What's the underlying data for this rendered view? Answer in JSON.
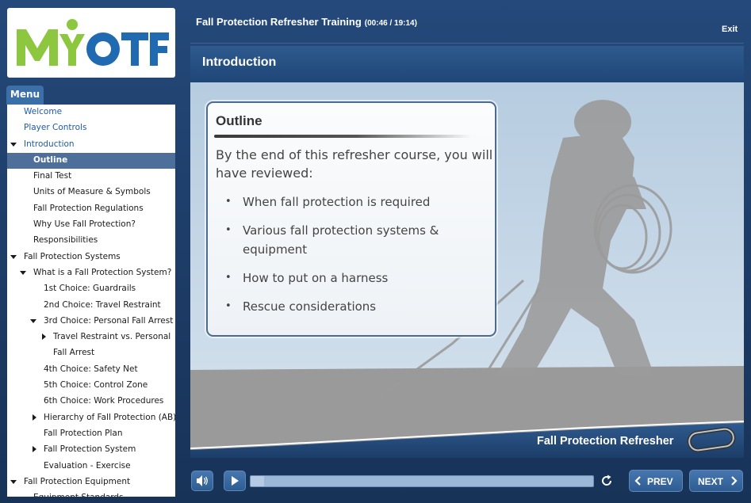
{
  "header": {
    "course_title": "Fall Protection Refresher Training",
    "course_time": "(00:46 / 19:14)",
    "exit_label": "Exit"
  },
  "logo": {
    "text": "MYOTF",
    "colors": {
      "green": "#8dc63f",
      "blue": "#1f6ab0"
    }
  },
  "menu": {
    "tab_label": "Menu",
    "items": [
      {
        "label": "Welcome",
        "level": 0,
        "caret": "none",
        "style": "blue"
      },
      {
        "label": "Player Controls",
        "level": 0,
        "caret": "none",
        "style": "blue"
      },
      {
        "label": "Introduction",
        "level": 0,
        "caret": "down",
        "style": "blue"
      },
      {
        "label": "Outline",
        "level": 1,
        "caret": "none",
        "style": "selected"
      },
      {
        "label": "Final Test",
        "level": 1,
        "caret": "none",
        "style": ""
      },
      {
        "label": "Units of Measure & Symbols",
        "level": 1,
        "caret": "none",
        "style": ""
      },
      {
        "label": "Fall Protection Regulations",
        "level": 1,
        "caret": "none",
        "style": ""
      },
      {
        "label": "Why Use Fall Protection?",
        "level": 1,
        "caret": "none",
        "style": ""
      },
      {
        "label": "Responsibilities",
        "level": 1,
        "caret": "none",
        "style": ""
      },
      {
        "label": "Fall Protection Systems",
        "level": 0,
        "caret": "down",
        "style": ""
      },
      {
        "label": "What is a Fall Protection System?",
        "level": 1,
        "caret": "down",
        "style": ""
      },
      {
        "label": "1st Choice: Guardrails",
        "level": 2,
        "caret": "none",
        "style": ""
      },
      {
        "label": "2nd Choice: Travel Restraint",
        "level": 2,
        "caret": "none",
        "style": ""
      },
      {
        "label": "3rd Choice: Personal Fall Arrest",
        "level": 2,
        "caret": "down",
        "style": ""
      },
      {
        "label": "Travel Restraint vs. Personal",
        "level": 3,
        "caret": "right",
        "style": ""
      },
      {
        "label": "Fall Arrest",
        "level": 3,
        "caret": "none",
        "style": ""
      },
      {
        "label": "4th Choice: Safety Net",
        "level": 2,
        "caret": "none",
        "style": ""
      },
      {
        "label": "5th Choice: Control Zone",
        "level": 2,
        "caret": "none",
        "style": ""
      },
      {
        "label": "6th Choice: Work Procedures",
        "level": 2,
        "caret": "none",
        "style": ""
      },
      {
        "label": "Hierarchy of Fall Protection (AB)",
        "level": 2,
        "caret": "right",
        "style": ""
      },
      {
        "label": "Fall Protection Plan",
        "level": 2,
        "caret": "none",
        "style": ""
      },
      {
        "label": "Fall Protection System",
        "level": 2,
        "caret": "right",
        "style": ""
      },
      {
        "label": "Evaluation - Exercise",
        "level": 2,
        "caret": "none",
        "style": ""
      },
      {
        "label": "Fall Protection Equipment",
        "level": 0,
        "caret": "down",
        "style": ""
      },
      {
        "label": "Equipment Standards",
        "level": 1,
        "caret": "none",
        "style": ""
      }
    ]
  },
  "slide": {
    "title": "Introduction",
    "card": {
      "heading": "Outline",
      "intro": "By the end of this refresher course, you will have reviewed:",
      "bullets": [
        "When fall protection is required",
        "Various fall protection systems & equipment",
        "How to put on a harness",
        "Rescue considerations"
      ]
    },
    "footer_text": "Fall Protection Refresher"
  },
  "controls": {
    "prev_label": "PREV",
    "next_label": "NEXT",
    "progress": 0.04
  },
  "colors": {
    "frame": "#1f4270",
    "accent": "#3a6fa8",
    "selected": "#4d6f9a",
    "link": "#1f5aa6"
  }
}
